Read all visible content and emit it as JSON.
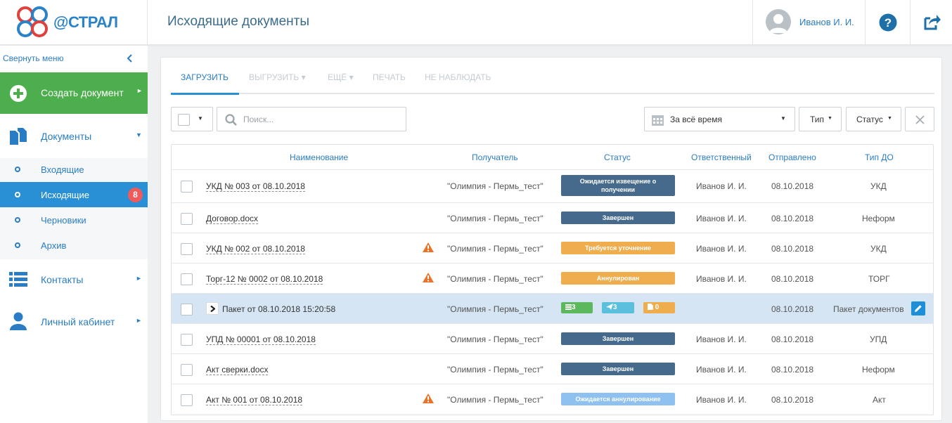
{
  "brand": {
    "logo_text": "@СТРАЛ"
  },
  "header": {
    "title": "Исходящие документы",
    "user_name": "Иванов И. И."
  },
  "sidebar": {
    "collapse_label": "Свернуть меню",
    "create_label": "Создать документ",
    "documents_label": "Документы",
    "sub_items": [
      {
        "label": "Входящие"
      },
      {
        "label": "Исходящие",
        "badge": "8"
      },
      {
        "label": "Черновики"
      },
      {
        "label": "Архив"
      }
    ],
    "contacts_label": "Контакты",
    "cabinet_label": "Личный кабинет"
  },
  "tabs": [
    {
      "label": "ЗАГРУЗИТЬ"
    },
    {
      "label": "ВЫГРУЗИТЬ ▾"
    },
    {
      "label": "ЕЩЁ ▾"
    },
    {
      "label": "ПЕЧАТЬ"
    },
    {
      "label": "НЕ НАБЛЮДАТЬ"
    }
  ],
  "filters": {
    "search_placeholder": "Поиск...",
    "period": "За всё время",
    "type_label": "Тип",
    "status_label": "Статус"
  },
  "table": {
    "columns": [
      "Наименование",
      "Получатель",
      "Статус",
      "Ответственный",
      "Отправлено",
      "Тип ДО"
    ],
    "rows": [
      {
        "name": "УКД № 003 от 08.10.2018",
        "recipient": "\"Олимпия - Пермь_тест\"",
        "status": "Ожидается извещение о получении",
        "responsible": "Иванов И. И.",
        "sent": "08.10.2018",
        "type": "УКД"
      },
      {
        "name": "Договор.docx",
        "recipient": "\"Олимпия - Пермь_тест\"",
        "status": "Завершен",
        "responsible": "Иванов И. И.",
        "sent": "08.10.2018",
        "type": "Неформ"
      },
      {
        "name": "УКД № 002 от 08.10.2018",
        "recipient": "\"Олимпия - Пермь_тест\"",
        "status": "Требуется уточнение",
        "responsible": "Иванов И. И.",
        "sent": "08.10.2018",
        "type": "УКД"
      },
      {
        "name": "Торг-12 № 0002 от 08.10.2018",
        "recipient": "\"Олимпия - Пермь_тест\"",
        "status": "Аннулирован",
        "responsible": "Иванов И. И.",
        "sent": "08.10.2018",
        "type": "ТОРГ"
      },
      {
        "name": "Пакет от 08.10.2018 15:20:58",
        "recipient": "\"Олимпия - Пермь_тест\"",
        "pills": [
          "3",
          "3",
          "0"
        ],
        "sent": "08.10.2018",
        "type": "Пакет документов"
      },
      {
        "name": "УПД № 00001 от 08.10.2018",
        "recipient": "\"Олимпия - Пермь_тест\"",
        "status": "Завершен",
        "responsible": "Иванов И. И.",
        "sent": "08.10.2018",
        "type": "УПД"
      },
      {
        "name": "Акт сверки.docx",
        "recipient": "\"Олимпия - Пермь_тест\"",
        "status": "Завершен",
        "responsible": "Иванов И. И.",
        "sent": "08.10.2018",
        "type": "Неформ"
      },
      {
        "name": "Акт № 001 от 08.10.2018",
        "recipient": "\"Олимпия - Пермь_тест\"",
        "status": "Ожидается аннулирование",
        "responsible": "Иванов И. И.",
        "sent": "08.10.2018",
        "type": "Акт"
      }
    ]
  },
  "colors": {
    "status_done": "#456a8b",
    "status_waiting": "#456a8b",
    "status_clarify": "#f0ad4e",
    "status_cancelled": "#f0ad4e",
    "status_cancel_pending": "#8ec1ef",
    "pill_green": "#5cb85c",
    "pill_blue": "#5bc0de",
    "pill_orange": "#f0ad4e"
  }
}
